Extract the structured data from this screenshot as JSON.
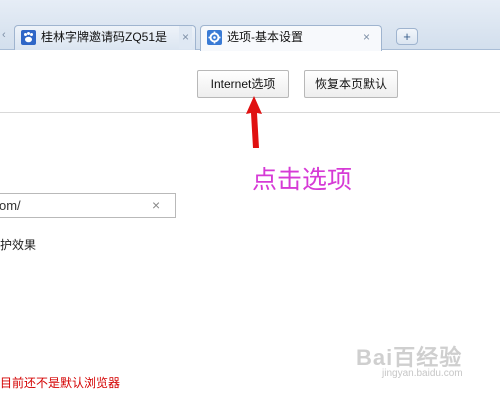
{
  "tabs": [
    {
      "title": "桂林字牌邀请码ZQ51是",
      "active": false,
      "favicon": "paw-icon"
    },
    {
      "title": "选项-基本设置",
      "active": true,
      "favicon": "gear-icon"
    }
  ],
  "new_tab_label": "+",
  "close_glyph": "×",
  "toolbar": {
    "internet_options_label": "Internet选项",
    "restore_defaults_label": "恢复本页默认"
  },
  "annotation": {
    "text": "点击选项",
    "color": "#d63ad6"
  },
  "url_field": {
    "value": "om/"
  },
  "protect_label": "护效果",
  "default_browser_warning": "目前还不是默认浏览器",
  "watermark": {
    "brand": "Bai百经验",
    "url": "jingyan.baidu.com"
  },
  "colors": {
    "accent": "#3a7bd5",
    "warning": "#d40000",
    "annotation": "#d63ad6"
  }
}
